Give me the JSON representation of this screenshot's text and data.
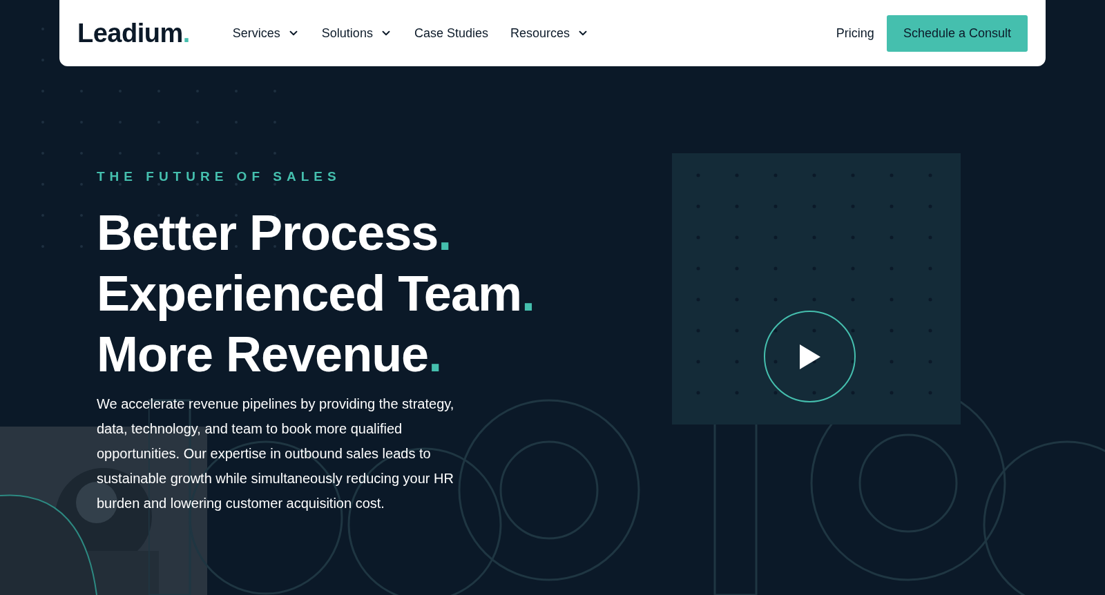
{
  "nav": {
    "logo": "Leadium",
    "logo_dot": ".",
    "items": [
      {
        "label": "Services",
        "dropdown": true
      },
      {
        "label": "Solutions",
        "dropdown": true
      },
      {
        "label": "Case Studies",
        "dropdown": false
      },
      {
        "label": "Resources",
        "dropdown": true
      }
    ],
    "pricing": "Pricing",
    "cta": "Schedule a Consult"
  },
  "hero": {
    "eyebrow": "THE FUTURE OF SALES",
    "headline": [
      {
        "text": "Better Process",
        "mark": "."
      },
      {
        "text": "Experienced Team",
        "mark": "."
      },
      {
        "text": "More Revenue",
        "mark": "."
      }
    ],
    "body": "We accelerate revenue pipelines by providing the strategy, data, technology, and team to book more qualified opportunities. Our expertise in outbound sales leads to sustainable growth while simultaneously reducing your HR burden and lowering customer acquisition cost."
  }
}
